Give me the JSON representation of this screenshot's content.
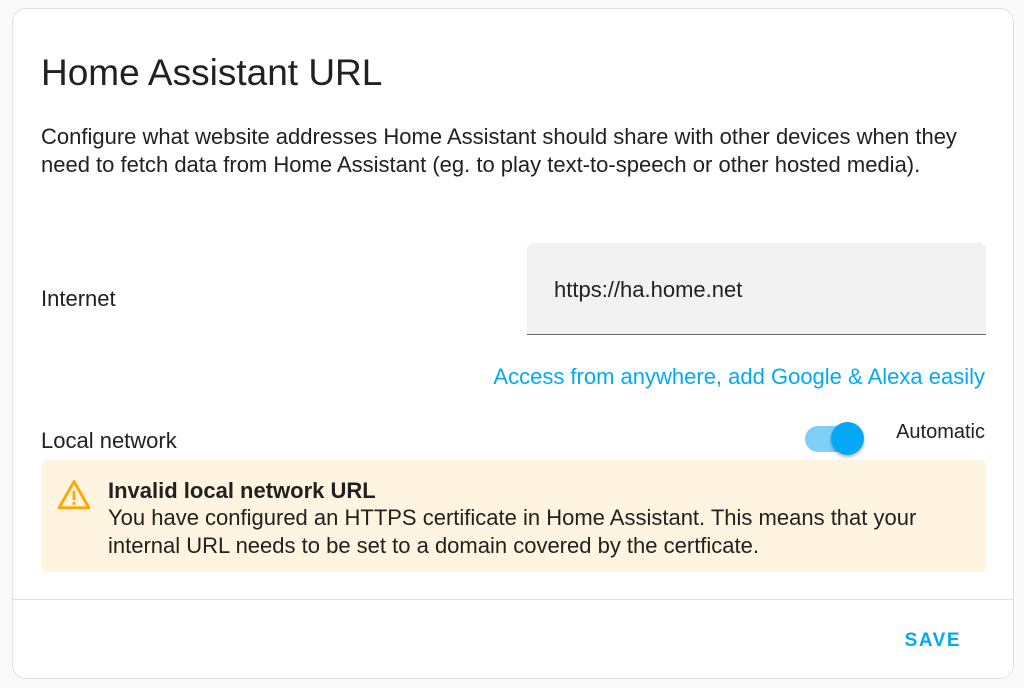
{
  "dialog": {
    "title": "Home Assistant URL",
    "description": "Configure what website addresses Home Assistant should share with other devices when they need to fetch data from Home Assistant (eg. to play text-to-speech or other hosted media)."
  },
  "internet": {
    "label": "Internet",
    "value": "https://ha.home.net",
    "cloud_link": "Access from anywhere, add Google & Alexa easily"
  },
  "local": {
    "label": "Local network",
    "toggle_label": "Automatic",
    "toggle_on": true
  },
  "alert": {
    "icon": "warning-icon",
    "title": "Invalid local network URL",
    "body": "You have configured an HTTPS certificate in Home Assistant. This means that your internal URL needs to be set to a domain covered by the certficate."
  },
  "actions": {
    "save_label": "SAVE"
  },
  "colors": {
    "accent": "#03a9f4",
    "warning": "#ffa600",
    "warning_bg": "#fff4e0"
  }
}
